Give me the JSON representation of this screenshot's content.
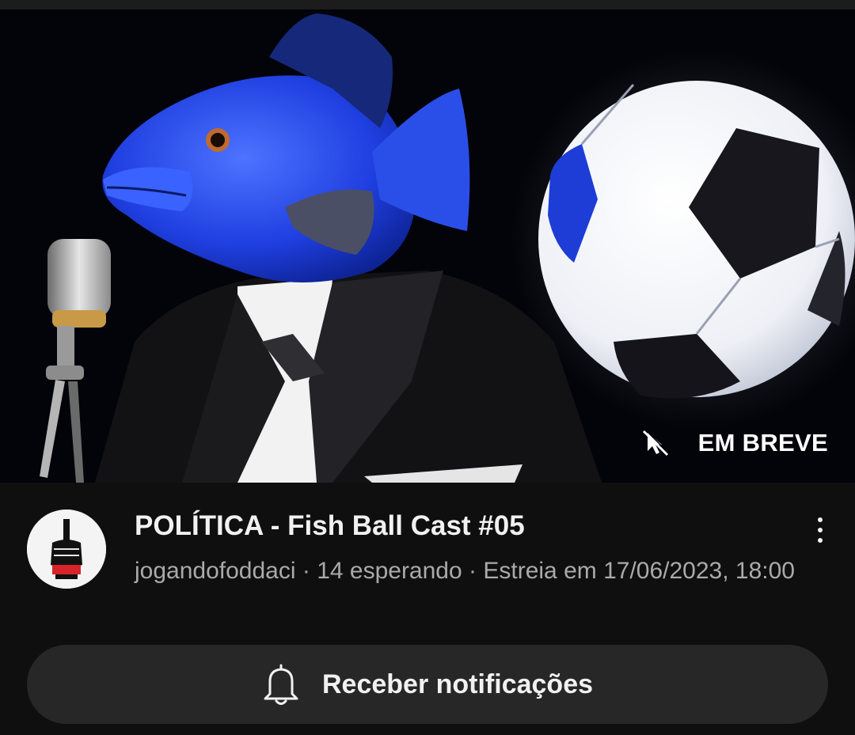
{
  "video": {
    "badge_label": "EM BREVE",
    "badge_icon": "cursor-slash-icon",
    "thumbnail_subject": "fish-in-suit-with-microphone-and-soccer-ball"
  },
  "meta": {
    "title": "POLÍTICA - Fish Ball Cast #05",
    "channel": "jogandofoddaci",
    "separator": " · ",
    "waiting": "14 esperando",
    "premiere": "Estreia em 17/06/2023, 18:00"
  },
  "actions": {
    "notify_label": "Receber notificações",
    "notify_icon": "bell-icon",
    "more_icon": "more-vert-icon"
  },
  "colors": {
    "background": "#0f0f0f",
    "button_bg": "#272727",
    "text_primary": "#f1f1f1",
    "text_secondary": "#aaaaaa"
  }
}
